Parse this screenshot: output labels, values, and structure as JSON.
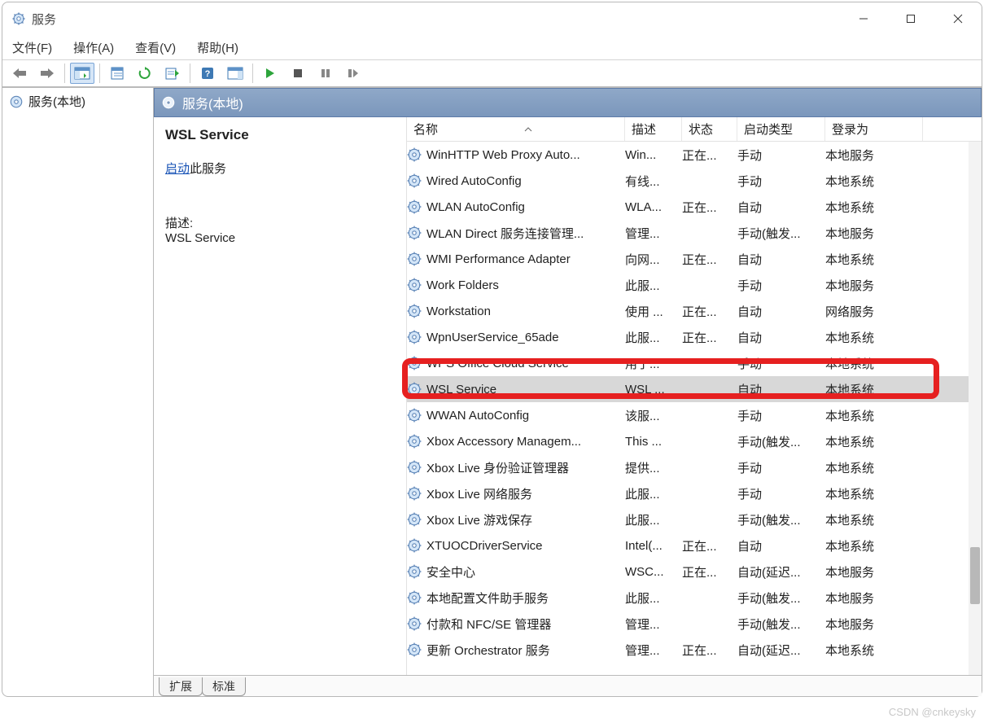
{
  "window": {
    "title": "服务"
  },
  "menubar": [
    "文件(F)",
    "操作(A)",
    "查看(V)",
    "帮助(H)"
  ],
  "nav": {
    "item": "服务(本地)"
  },
  "detail": {
    "header": "服务(本地)",
    "service_name": "WSL Service",
    "start_link": "启动",
    "start_suffix": "此服务",
    "desc_label": "描述:",
    "desc_text": "WSL Service"
  },
  "columns": {
    "name": "名称",
    "desc": "描述",
    "status": "状态",
    "start": "启动类型",
    "logon": "登录为"
  },
  "rows": [
    {
      "name": "WinHTTP Web Proxy Auto...",
      "desc": "Win...",
      "status": "正在...",
      "start": "手动",
      "logon": "本地服务"
    },
    {
      "name": "Wired AutoConfig",
      "desc": "有线...",
      "status": "",
      "start": "手动",
      "logon": "本地系统"
    },
    {
      "name": "WLAN AutoConfig",
      "desc": "WLA...",
      "status": "正在...",
      "start": "自动",
      "logon": "本地系统"
    },
    {
      "name": "WLAN Direct 服务连接管理...",
      "desc": "管理...",
      "status": "",
      "start": "手动(触发...",
      "logon": "本地服务"
    },
    {
      "name": "WMI Performance Adapter",
      "desc": "向网...",
      "status": "正在...",
      "start": "自动",
      "logon": "本地系统"
    },
    {
      "name": "Work Folders",
      "desc": "此服...",
      "status": "",
      "start": "手动",
      "logon": "本地服务"
    },
    {
      "name": "Workstation",
      "desc": "使用 ...",
      "status": "正在...",
      "start": "自动",
      "logon": "网络服务"
    },
    {
      "name": "WpnUserService_65ade",
      "desc": "此服...",
      "status": "正在...",
      "start": "自动",
      "logon": "本地系统"
    },
    {
      "name": "WPS Office Cloud Service",
      "desc": "用于...",
      "status": "",
      "start": "手动",
      "logon": "本地系统"
    },
    {
      "name": "WSL Service",
      "desc": "WSL ...",
      "status": "",
      "start": "自动",
      "logon": "本地系统",
      "selected": true
    },
    {
      "name": "WWAN AutoConfig",
      "desc": "该服...",
      "status": "",
      "start": "手动",
      "logon": "本地系统"
    },
    {
      "name": "Xbox Accessory Managem...",
      "desc": "This ...",
      "status": "",
      "start": "手动(触发...",
      "logon": "本地系统"
    },
    {
      "name": "Xbox Live 身份验证管理器",
      "desc": "提供...",
      "status": "",
      "start": "手动",
      "logon": "本地系统"
    },
    {
      "name": "Xbox Live 网络服务",
      "desc": "此服...",
      "status": "",
      "start": "手动",
      "logon": "本地系统"
    },
    {
      "name": "Xbox Live 游戏保存",
      "desc": "此服...",
      "status": "",
      "start": "手动(触发...",
      "logon": "本地系统"
    },
    {
      "name": "XTUOCDriverService",
      "desc": "Intel(...",
      "status": "正在...",
      "start": "自动",
      "logon": "本地系统"
    },
    {
      "name": "安全中心",
      "desc": "WSC...",
      "status": "正在...",
      "start": "自动(延迟...",
      "logon": "本地服务"
    },
    {
      "name": "本地配置文件助手服务",
      "desc": "此服...",
      "status": "",
      "start": "手动(触发...",
      "logon": "本地服务"
    },
    {
      "name": "付款和 NFC/SE 管理器",
      "desc": "管理...",
      "status": "",
      "start": "手动(触发...",
      "logon": "本地服务"
    },
    {
      "name": "更新 Orchestrator 服务",
      "desc": "管理...",
      "status": "正在...",
      "start": "自动(延迟...",
      "logon": "本地系统"
    }
  ],
  "tabs": {
    "extended": "扩展",
    "standard": "标准"
  },
  "icons": {
    "gear": "gear-icon",
    "back": "back-icon",
    "fwd": "forward-icon",
    "showhide": "show-hide-pane-icon",
    "props": "properties-icon",
    "refresh": "refresh-icon",
    "export": "export-list-icon",
    "help": "help-icon",
    "pane": "preview-pane-icon",
    "play": "start-service-icon",
    "stop": "stop-service-icon",
    "pause": "pause-service-icon",
    "step": "restart-service-icon"
  },
  "watermark": "CSDN @cnkeysky"
}
